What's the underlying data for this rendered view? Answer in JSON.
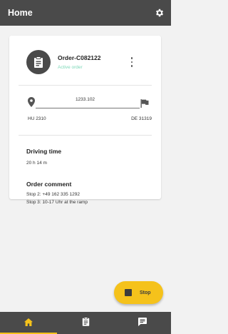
{
  "header": {
    "title": "Home",
    "settings_icon": "gear-icon"
  },
  "order": {
    "id": "Order-C082122",
    "status": "Active order",
    "status_color": "#7ed8b8",
    "icon": "clipboard-icon"
  },
  "route": {
    "distance": "1233.102",
    "from": "HU 2310",
    "to": "DE 31319",
    "start_icon": "map-pin-icon",
    "end_icon": "flag-icon"
  },
  "driving_time": {
    "label": "Driving time",
    "value": "20 h 14 m"
  },
  "order_comment": {
    "label": "Order comment",
    "lines": [
      "Stop 2: +49 162 335 1292",
      "Stop 3: 10-17 Uhr at the ramp"
    ]
  },
  "fab": {
    "label": "Stop",
    "color": "#f5c21b",
    "icon": "stop-icon"
  },
  "bottom_nav": {
    "items": [
      {
        "icon": "home-icon",
        "active": true
      },
      {
        "icon": "clipboard-icon",
        "active": false
      },
      {
        "icon": "chat-icon",
        "active": false
      }
    ],
    "accent": "#f5c21b"
  }
}
